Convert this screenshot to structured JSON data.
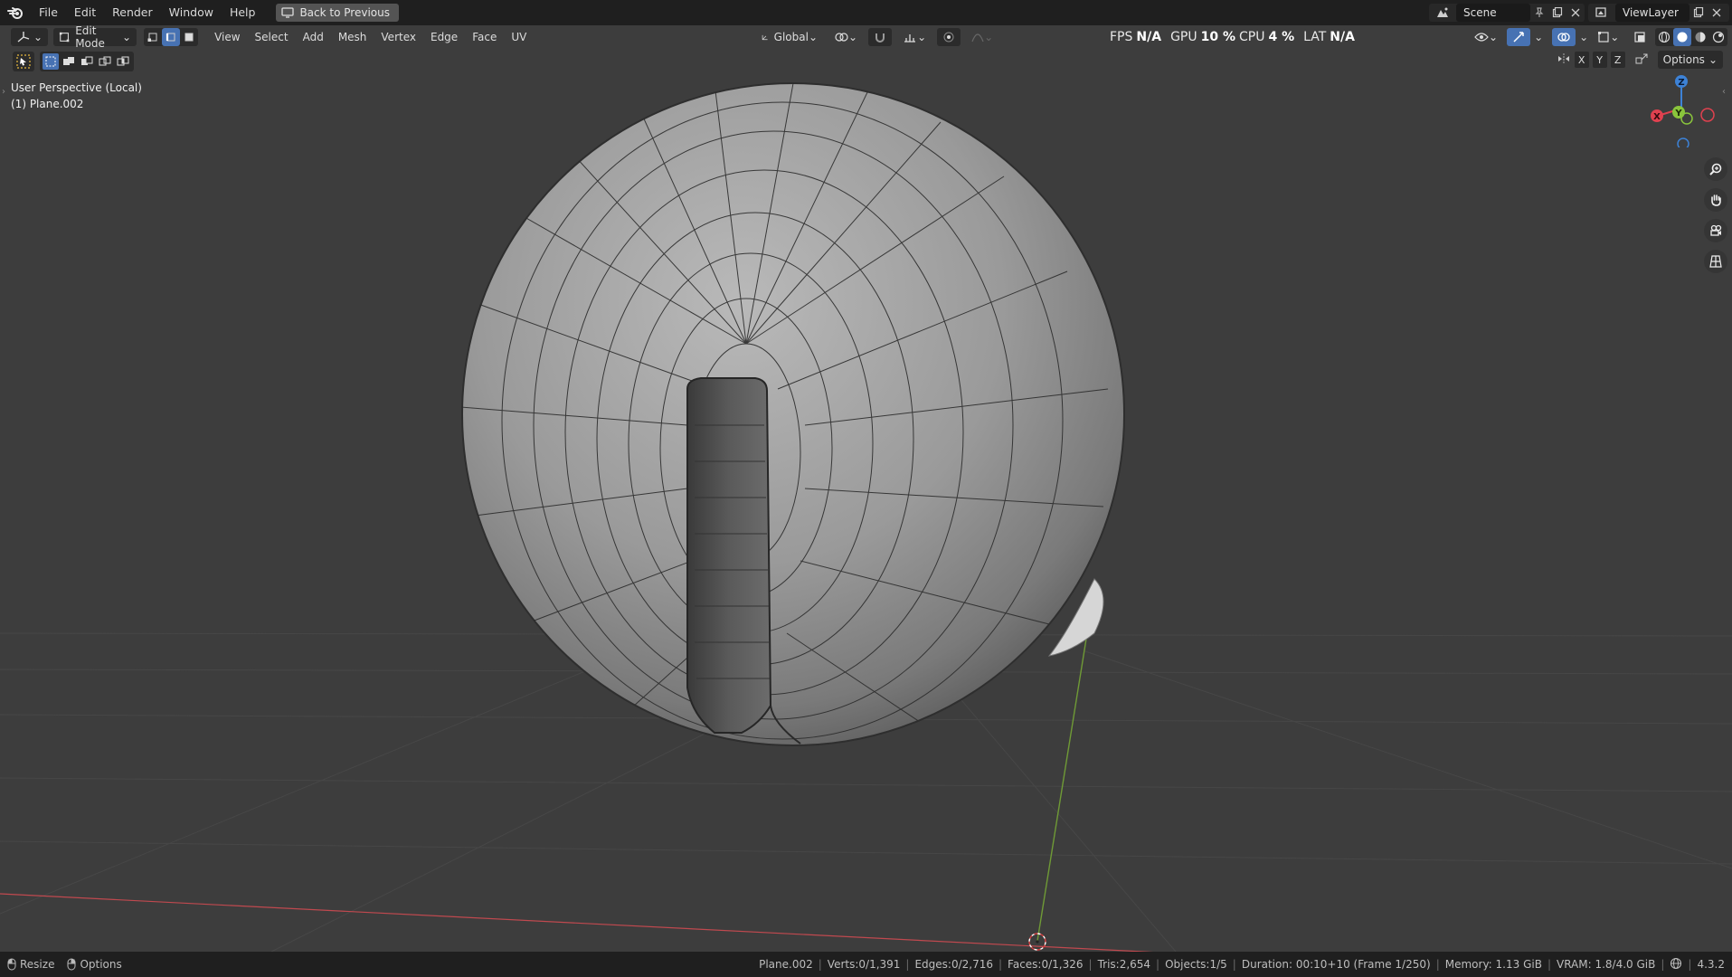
{
  "topbar": {
    "menu": [
      "File",
      "Edit",
      "Render",
      "Window",
      "Help"
    ],
    "back_label": "Back to Previous",
    "scene_name": "Scene",
    "viewlayer_name": "ViewLayer"
  },
  "header": {
    "mode_label": "Edit Mode",
    "menus": [
      "View",
      "Select",
      "Add",
      "Mesh",
      "Vertex",
      "Edge",
      "Face",
      "UV"
    ],
    "transform_label": "Global",
    "options_label": "Options",
    "axes": [
      "X",
      "Y",
      "Z"
    ],
    "select_mode_active": "edge"
  },
  "stats": {
    "fps_label": "FPS",
    "fps_value": "N/A",
    "gpu_label": "GPU",
    "gpu_value": "10 %",
    "cpu_label": "CPU",
    "cpu_value": "4 %",
    "lat_label": "LAT",
    "lat_value": "N/A"
  },
  "viewport": {
    "perspective": "User Perspective (Local)",
    "object": "(1) Plane.002",
    "gizmo": {
      "x": "X",
      "y": "Y",
      "z": "Z"
    }
  },
  "statusbar": {
    "left": [
      "Resize",
      "Options"
    ],
    "object": "Plane.002",
    "verts": "Verts:0/1,391",
    "edges": "Edges:0/2,716",
    "faces": "Faces:0/1,326",
    "tris": "Tris:2,654",
    "objects": "Objects:1/5",
    "duration": "Duration: 00:10+10 (Frame 1/250)",
    "memory": "Memory: 1.13 GiB",
    "vram": "VRAM: 1.8/4.0 GiB",
    "version": "4.3.2"
  },
  "colors": {
    "viewport_bg": "#3d3d3d",
    "accent": "#4772b3",
    "x_axis": "#e0414f",
    "y_axis": "#8ac53c",
    "z_axis": "#3d82d6"
  }
}
